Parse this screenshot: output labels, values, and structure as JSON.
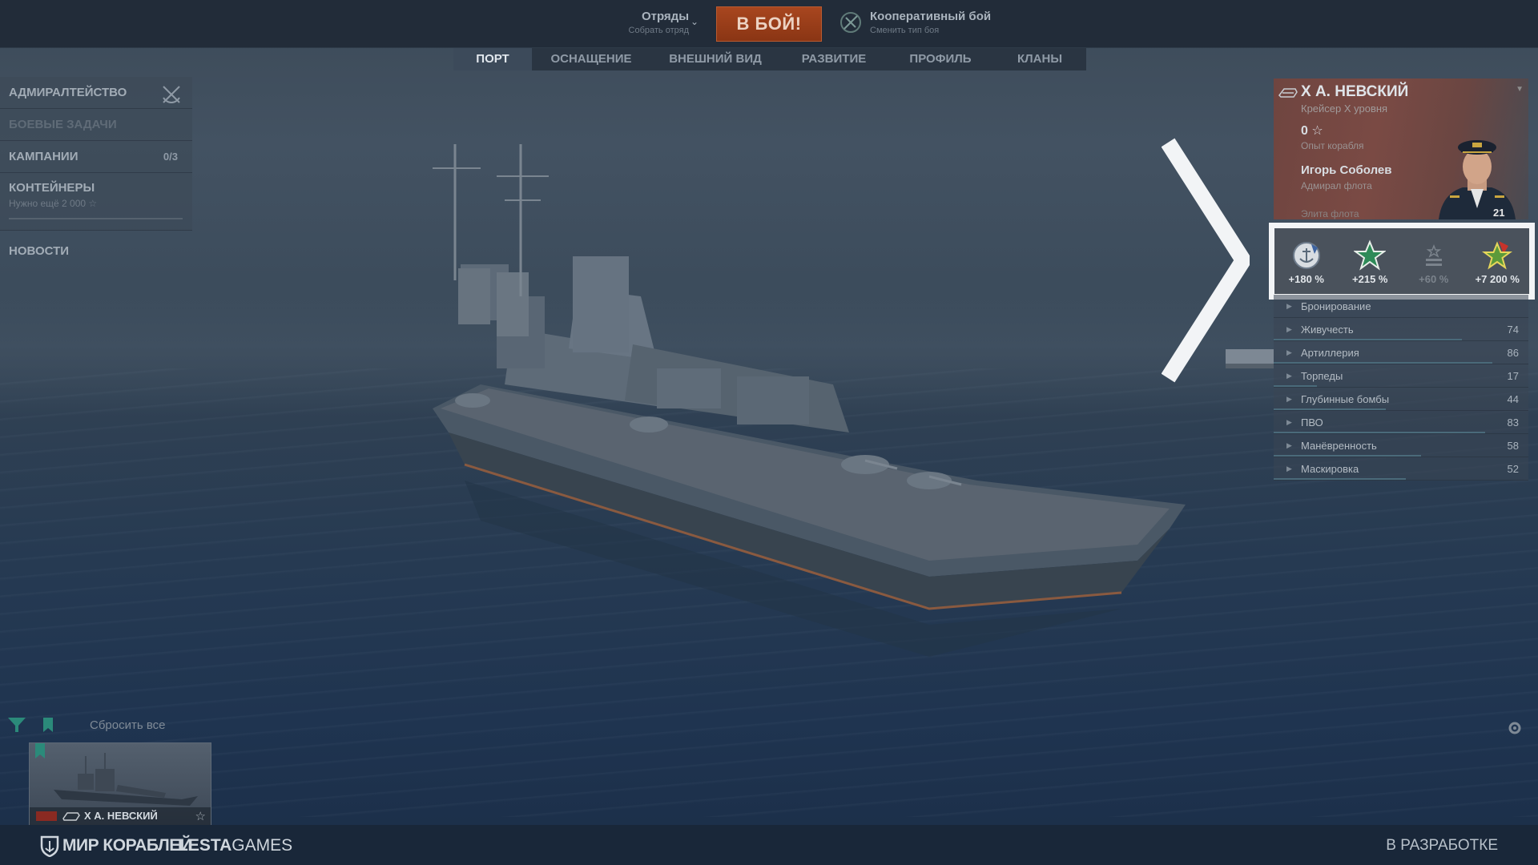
{
  "topbar": {
    "squad_title": "Отряды",
    "squad_sub": "Собрать отряд",
    "battle_label": "В БОЙ!",
    "mode_title": "Кооперативный бой",
    "mode_sub": "Сменить тип боя"
  },
  "tabs": [
    "ПОРТ",
    "ОСНАЩЕНИЕ",
    "ВНЕШНИЙ ВИД",
    "РАЗВИТИЕ",
    "ПРОФИЛЬ",
    "КЛАНЫ"
  ],
  "active_tab": "ПОРТ",
  "leftmenu": {
    "admiralty": "АДМИРАЛТЕЙСТВО",
    "tasks": "БОЕВЫЕ ЗАДАЧИ",
    "campaigns": "КАМПАНИИ",
    "campaigns_count": "0/3",
    "containers": "КОНТЕЙНЕРЫ",
    "containers_sub": "Нужно ещё  2 000 ☆",
    "news": "НОВОСТИ"
  },
  "ship": {
    "name": "X А. НЕВСКИЙ",
    "class": "Крейсер X уровня",
    "xp": "0 ☆",
    "xp_label": "Опыт корабля",
    "captain": "Игорь Соболев",
    "captain_rank": "Адмирал флота",
    "elite": "Элита флота",
    "commander_level": "21"
  },
  "bonuses": [
    {
      "icon": "anchor-medal-icon",
      "value": "+180 %",
      "active": true
    },
    {
      "icon": "green-star-icon",
      "value": "+215 %",
      "active": true
    },
    {
      "icon": "grey-rank-icon",
      "value": "+60 %",
      "active": false
    },
    {
      "icon": "red-star-icon",
      "value": "+7 200 %",
      "active": true
    }
  ],
  "stats": [
    {
      "label": "Бронирование",
      "value": "",
      "level": 0
    },
    {
      "label": "Живучесть",
      "value": "74",
      "level": 0.74
    },
    {
      "label": "Артиллерия",
      "value": "86",
      "level": 0.86
    },
    {
      "label": "Торпеды",
      "value": "17",
      "level": 0.17
    },
    {
      "label": "Глубинные бомбы",
      "value": "44",
      "level": 0.44
    },
    {
      "label": "ПВО",
      "value": "83",
      "level": 0.83
    },
    {
      "label": "Манёвренность",
      "value": "58",
      "level": 0.58
    },
    {
      "label": "Маскировка",
      "value": "52",
      "level": 0.52
    }
  ],
  "carousel": {
    "reset_label": "Сбросить все",
    "card_name": "X А. НЕВСКИЙ"
  },
  "footer": {
    "logo_game": "МИР КОРАБЛЕЙ",
    "logo_company_bold": "LESTA",
    "logo_company": "GAMES",
    "status": "В РАЗРАБОТКЕ"
  },
  "colors": {
    "battle_button": "#9a3d18",
    "highlight": "#f2f4f6",
    "topbar": "#222c39",
    "footer": "#192739"
  }
}
